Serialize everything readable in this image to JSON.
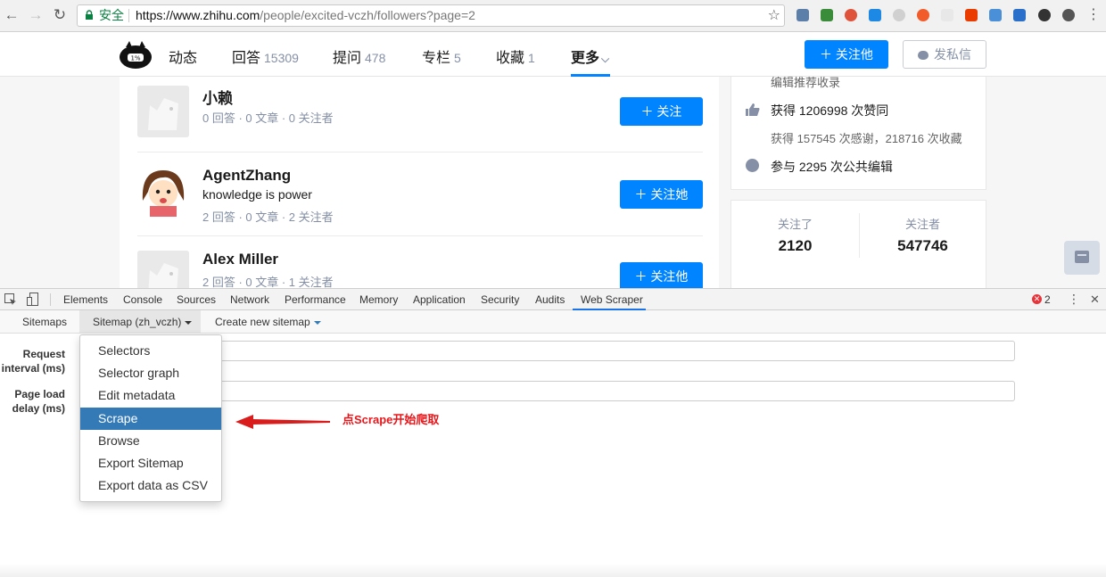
{
  "browser": {
    "back_icon": "←",
    "forward_icon": "→",
    "reload_icon": "↻",
    "secure_label": "安全",
    "url_host": "https://www.zhihu.com",
    "url_path": "/people/excited-vczh/followers?page=2",
    "star_icon": "☆",
    "menu_icon": "⋮"
  },
  "zhihu": {
    "tabs": [
      {
        "label": "动态",
        "count": ""
      },
      {
        "label": "回答",
        "count": "15309"
      },
      {
        "label": "提问",
        "count": "478"
      },
      {
        "label": "专栏",
        "count": "5"
      },
      {
        "label": "收藏",
        "count": "1"
      },
      {
        "label": "更多",
        "count": ""
      }
    ],
    "more_caret": "⌵",
    "follow_him_label": "＋ 关注他",
    "message_label": "发私信",
    "followers": [
      {
        "name": "小赖",
        "bio": "",
        "meta": "0 回答 · 0 文章 · 0 关注者",
        "button": "＋ 关注"
      },
      {
        "name": "AgentZhang",
        "bio": "knowledge is power",
        "meta": "2 回答 · 0 文章 · 2 关注者",
        "button": "＋ 关注她"
      },
      {
        "name": "Alex Miller",
        "bio": "",
        "meta": "2 回答 · 0 文章 · 1 关注者",
        "button": "＋ 关注他"
      }
    ],
    "achievements": {
      "top_cut": "编辑推荐收录",
      "likes": "获得 1206998 次赞同",
      "thanks": "获得 157545 次感谢，218716 次收藏",
      "edits": "参与 2295 次公共编辑"
    },
    "stats": {
      "following_label": "关注了",
      "following_value": "2120",
      "followers_label": "关注者",
      "followers_value": "547746"
    }
  },
  "devtools": {
    "tabs": [
      "Elements",
      "Console",
      "Sources",
      "Network",
      "Performance",
      "Memory",
      "Application",
      "Security",
      "Audits",
      "Web Scraper"
    ],
    "error_count": "2",
    "more_icon": "⋮",
    "close_icon": "✕",
    "nav": {
      "sitemaps": "Sitemaps",
      "current_sitemap": "Sitemap (zh_vczh)",
      "create_new": "Create new sitemap"
    },
    "form": {
      "request_interval_label_1": "Request",
      "request_interval_label_2": "interval (ms)",
      "page_load_label_1": "Page load",
      "page_load_label_2": "delay (ms)"
    },
    "dropdown_items": [
      "Selectors",
      "Selector graph",
      "Edit metadata",
      "Scrape",
      "Browse",
      "Export Sitemap",
      "Export data as CSV"
    ],
    "highlighted_item": "Scrape"
  },
  "annotation": {
    "text": "点Scrape开始爬取",
    "color": "#e8161a"
  },
  "colors": {
    "zhihu_blue": "#0084ff",
    "dropdown_highlight": "#337ab7",
    "meta_gray": "#8590a6"
  }
}
